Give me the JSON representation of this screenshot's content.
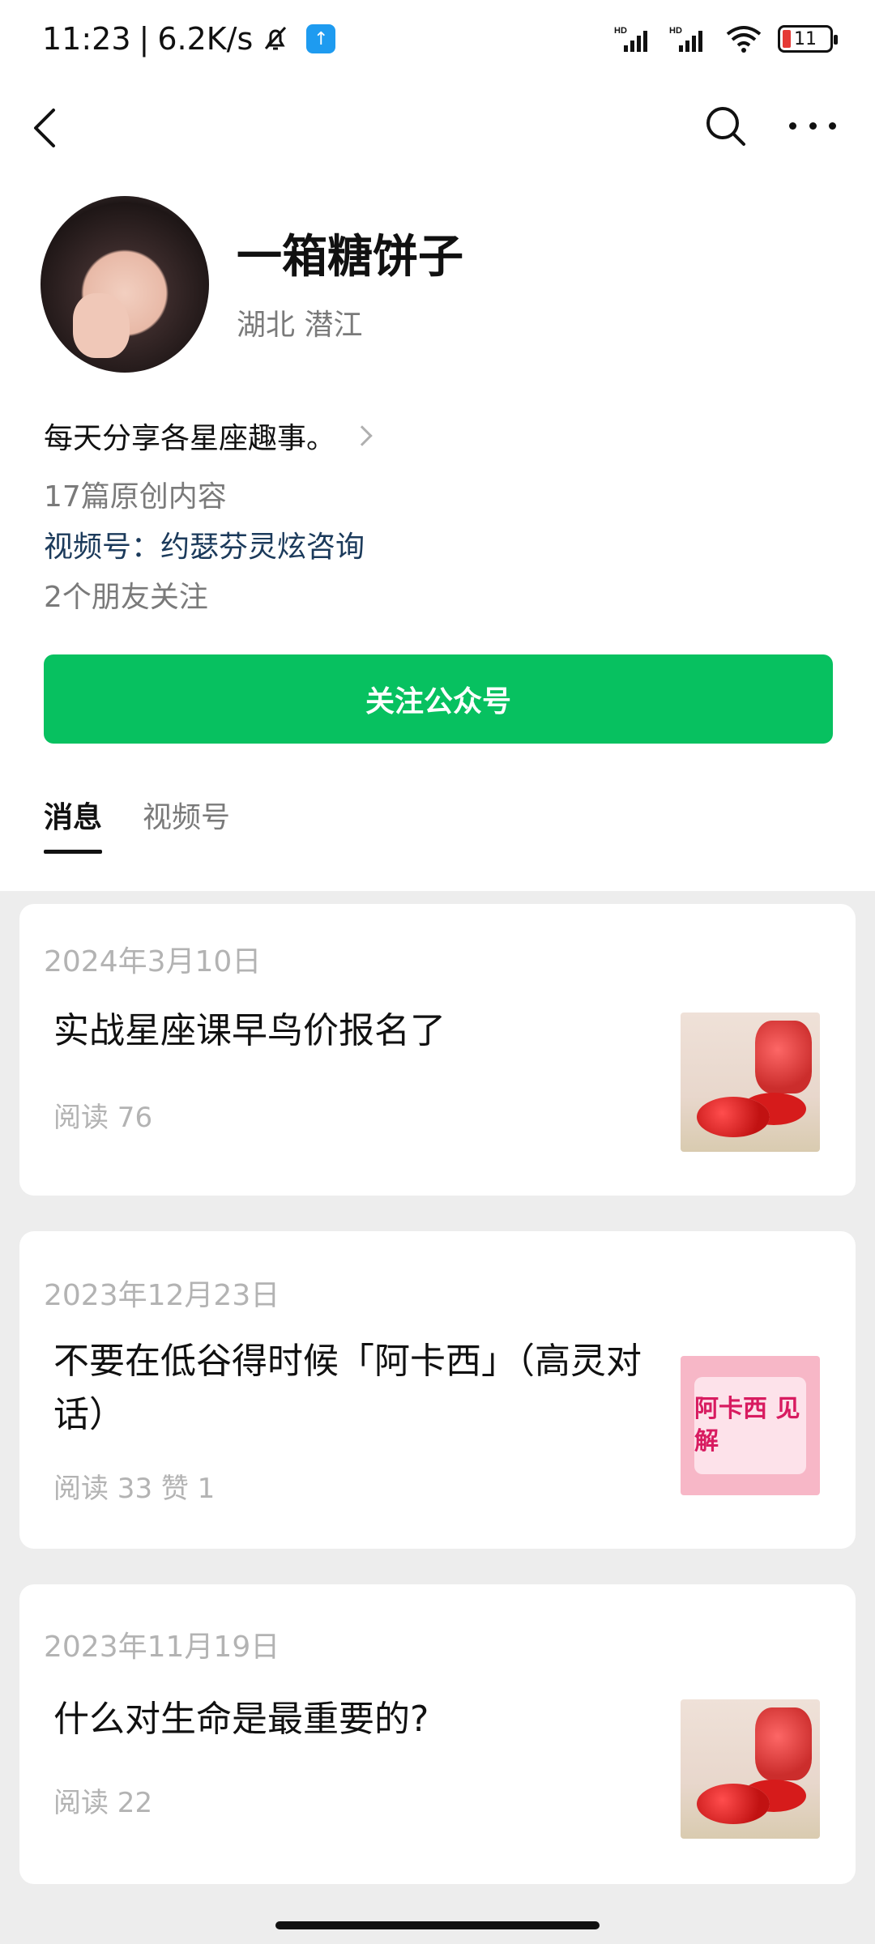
{
  "status_bar": {
    "time": "11:23",
    "separator": "|",
    "speed": "6.2K/s",
    "battery_level": "11",
    "network_1": "HD",
    "network_2": "HD"
  },
  "profile": {
    "name": "一箱糖饼子",
    "location": "湖北 潜江",
    "bio": "每天分享各星座趣事。",
    "original_count": "17篇原创内容",
    "channel": "视频号：约瑟芬灵炫咨询",
    "friends_follow": "2个朋友关注",
    "follow_button": "关注公众号"
  },
  "tabs": [
    {
      "label": "消息",
      "active": true
    },
    {
      "label": "视频号",
      "active": false
    }
  ],
  "articles": [
    {
      "date": "2024年3月10日",
      "title": "实战星座课早鸟价报名了",
      "stats": "阅读 76",
      "thumb": "strawberry-image"
    },
    {
      "date": "2023年12月23日",
      "title": "不要在低谷得时候「阿卡西」（高灵对话）",
      "stats": "阅读 33   赞 1",
      "thumb_text": "阿卡西 见解",
      "thumb": "akashi-image"
    },
    {
      "date": "2023年11月19日",
      "title": "什么对生命是最重要的?",
      "stats": "阅读 22",
      "thumb": "strawberry-image"
    }
  ],
  "colors": {
    "accent": "#07c160",
    "link": "#1b3a5b",
    "muted": "#7a7a7a"
  }
}
